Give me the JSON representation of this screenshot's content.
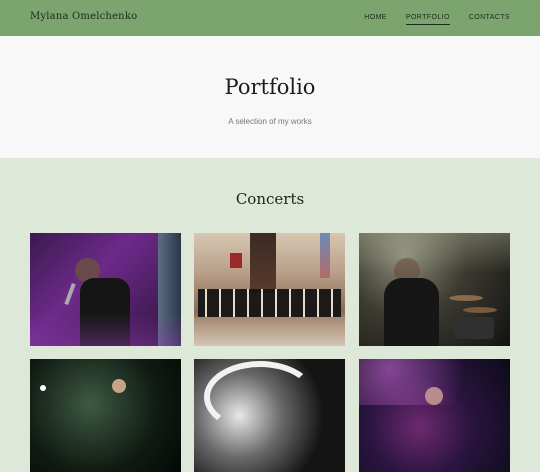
{
  "header": {
    "brand": "Mylana Omelchenko",
    "nav": [
      {
        "label": "HOME",
        "active": false
      },
      {
        "label": "PORTFOLIO",
        "active": true
      },
      {
        "label": "CONTACTS",
        "active": false
      }
    ]
  },
  "hero": {
    "title": "Portfolio",
    "subtitle": "A selection of my works"
  },
  "section": {
    "title": "Concerts"
  },
  "colors": {
    "header_bg": "#7ba46f",
    "hero_bg": "#f8f8f8",
    "section_bg": "#dde8d8"
  },
  "gallery": {
    "photos": [
      {
        "name": "concert-photo-singer-purple"
      },
      {
        "name": "concert-photo-choir-church"
      },
      {
        "name": "concert-photo-drummer"
      },
      {
        "name": "concert-photo-singer-dark"
      },
      {
        "name": "concert-photo-monochrome"
      },
      {
        "name": "concert-photo-purple-light"
      }
    ]
  }
}
